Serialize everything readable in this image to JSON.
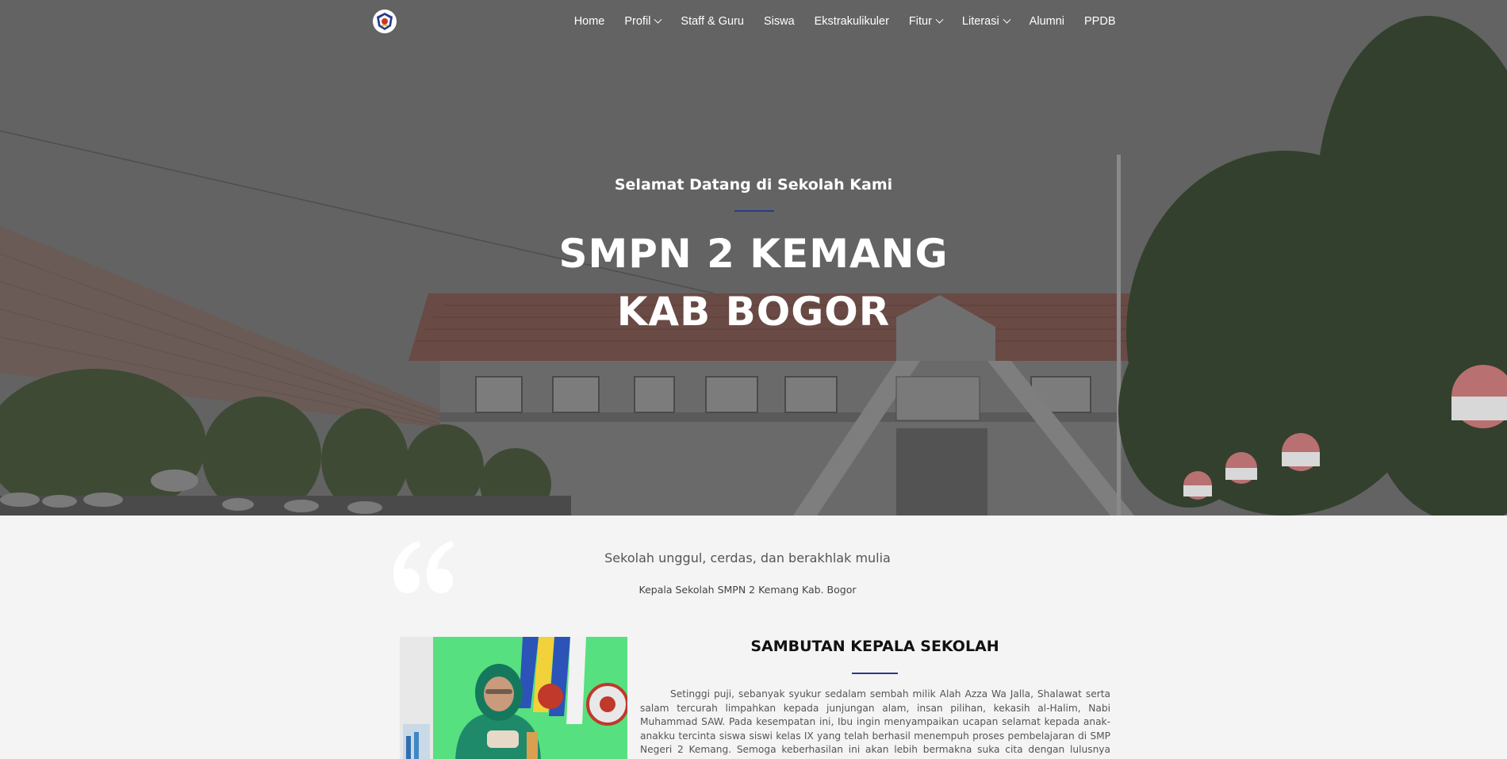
{
  "nav": {
    "logo_icon": "school-emblem-icon",
    "items": [
      {
        "label": "Home",
        "dropdown": false
      },
      {
        "label": "Profil",
        "dropdown": true
      },
      {
        "label": "Staff & Guru",
        "dropdown": false
      },
      {
        "label": "Siswa",
        "dropdown": false
      },
      {
        "label": "Ekstrakulikuler",
        "dropdown": false
      },
      {
        "label": "Fitur",
        "dropdown": true
      },
      {
        "label": "Literasi",
        "dropdown": true
      },
      {
        "label": "Alumni",
        "dropdown": false
      },
      {
        "label": "PPDB",
        "dropdown": false
      }
    ]
  },
  "hero": {
    "subtitle": "Selamat Datang di Sekolah Kami",
    "title_line1": "SMPN 2 KEMANG",
    "title_line2": "KAB BOGOR",
    "accent_color": "#2b3a8c"
  },
  "quote": {
    "icon": "quote-icon",
    "text": "Sekolah unggul, cerdas, dan berakhlak mulia",
    "author": "Kepala Sekolah SMPN 2 Kemang Kab. Bogor"
  },
  "sambutan": {
    "title": "SAMBUTAN KEPALA SEKOLAH",
    "body": "Setinggi puji, sebanyak syukur sedalam sembah milik Alah Azza Wa Jalla, Shalawat serta salam tercurah limpahkan kepada junjungan alam, insan pilihan, kekasih al-Halim, Nabi Muhammad SAW. Pada kesempatan ini, Ibu ingin menyampaikan ucapan selamat kepada anak-anakku tercinta siswa siswi kelas IX yang telah berhasil menempuh proses pembelajaran di SMP Negeri 2 Kemang. Semoga keberhasilan ini akan lebih bermakna suka cita dengan lulusnya kalian semua dalam"
  }
}
